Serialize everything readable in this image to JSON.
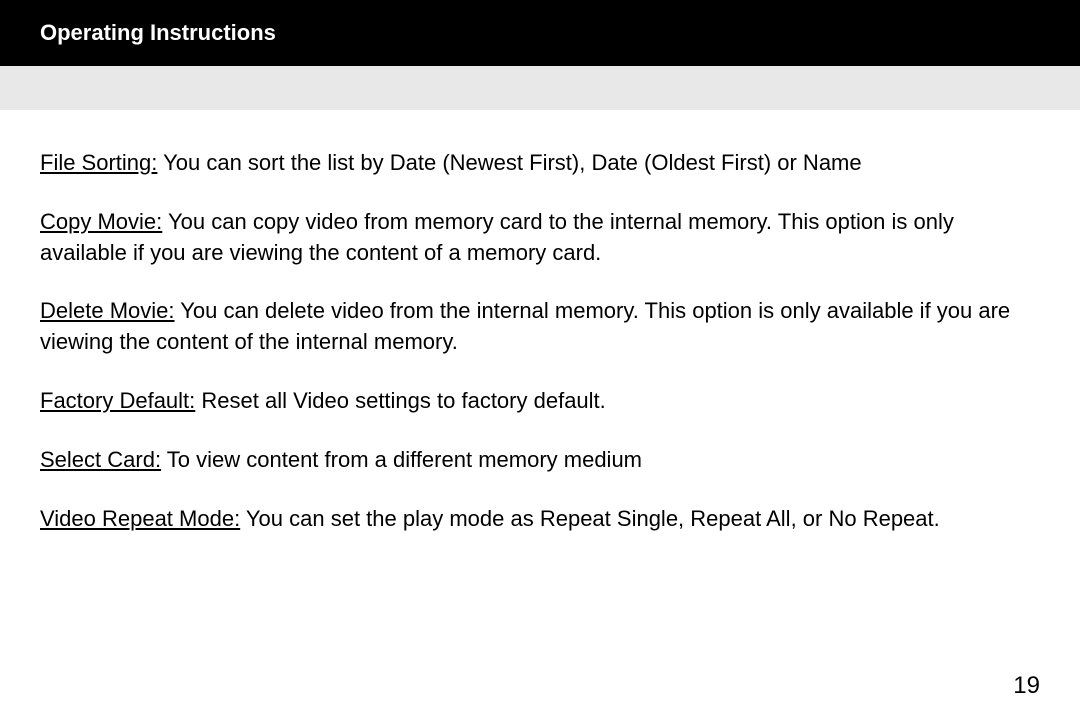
{
  "header": {
    "title": "Operating Instructions"
  },
  "entries": [
    {
      "label": "File Sorting:",
      "text": " You can sort the list by Date (Newest First), Date (Oldest First) or Name"
    },
    {
      "label": "Copy Movie:",
      "text": " You can copy video from memory card to the internal memory. This option is only available if you are viewing the content of a memory card."
    },
    {
      "label": "Delete Movie:",
      "text": " You can delete video from the internal memory. This option is only available if you are viewing the content of the internal memory."
    },
    {
      "label": "Factory Default:",
      "text": " Reset all Video settings to factory default."
    },
    {
      "label": "Select Card:",
      "text": " To view content from a different memory medium"
    },
    {
      "label": "Video Repeat Mode:",
      "text": " You can set the play mode as Repeat Single, Repeat All, or No Repeat."
    }
  ],
  "page_number": "19"
}
